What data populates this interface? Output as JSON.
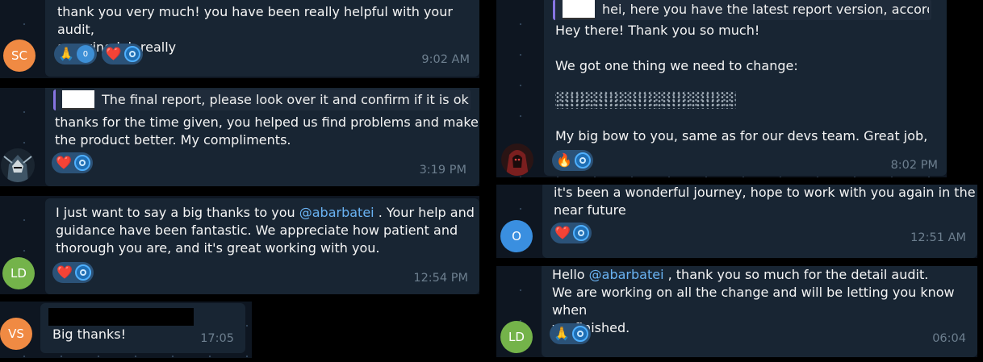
{
  "colors": {
    "background": "#000000",
    "chat_bg": "#0e1621",
    "bubble": "#182533",
    "mention": "#6ab3f3",
    "reaction_pill": "#2b5278",
    "timestamp": "#6d7f8f",
    "reply_bar": "#8774e1"
  },
  "messages": [
    {
      "avatar_initials": "SC",
      "avatar_color": "#f08a43",
      "text": "thank you very much! you have been really helpful with your audit,\namazing job really",
      "reactions": [
        {
          "emoji": "🙏",
          "count": "0"
        },
        {
          "emoji": "❤️"
        }
      ],
      "time": "9:02 AM"
    },
    {
      "avatar_icon": "knight-avatar-icon",
      "reply_preview": "The final report, please look over it and confirm if it is ok ...",
      "text": "thanks for the time given, you helped us find problems and make\nthe product better. My compliments.",
      "reactions": [
        {
          "emoji": "❤️"
        }
      ],
      "time": "3:19 PM"
    },
    {
      "avatar_initials": "LD",
      "avatar_color": "#74b34a",
      "text_before": "I just want to say a big thanks to you ",
      "mention": "@abarbatei",
      "text_after": " . Your help and\nguidance have been fantastic. We appreciate how patient and\nthorough you are, and it's great working with you.",
      "reactions": [
        {
          "emoji": "❤️"
        }
      ],
      "time": "12:54 PM"
    },
    {
      "avatar_initials": "VS",
      "avatar_color": "#f08a43",
      "text": "Big thanks!",
      "time": "17:05"
    },
    {
      "avatar_icon": "hooded-figure-avatar-icon",
      "reply_preview": "hei, here you have the latest report version, accordi...",
      "text_line1": "Hey there! Thank you so much!",
      "text_line2": "We got one thing we need to change:",
      "text_line3": "My big bow to you, same as for our devs team. Great job, guys.",
      "reactions": [
        {
          "emoji": "🔥"
        }
      ],
      "time": "8:02 PM"
    },
    {
      "avatar_initials": "O",
      "avatar_color": "#3a8fe0",
      "text": "it's been a wonderful journey, hope to work with you again in the\nnear future",
      "reactions": [
        {
          "emoji": "❤️"
        }
      ],
      "time": "12:51 AM"
    },
    {
      "avatar_initials": "LD",
      "avatar_color": "#74b34a",
      "text_before": "Hello ",
      "mention": "@abarbatei",
      "text_after": " , thank you so much for the detail audit.\nWe are working on all the change and will be letting you know when\nwe finished.",
      "reactions": [
        {
          "emoji": "🙏"
        }
      ],
      "time": "06:04"
    }
  ]
}
